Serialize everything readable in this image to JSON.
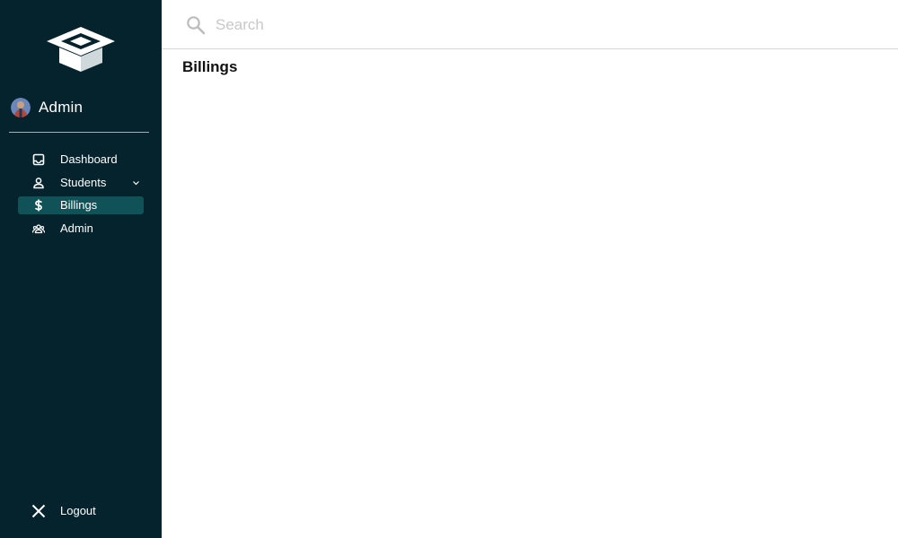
{
  "sidebar": {
    "logo_icon": "graduation-cap-icon",
    "user": {
      "name": "Admin",
      "avatar_icon": "avatar"
    },
    "items": [
      {
        "label": "Dashboard",
        "icon": "inbox-icon",
        "active": false
      },
      {
        "label": "Students",
        "icon": "person-icon",
        "active": false,
        "expandable": true
      },
      {
        "label": "Billings",
        "icon": "dollar-icon",
        "active": true
      },
      {
        "label": "Admin",
        "icon": "group-icon",
        "active": false
      }
    ],
    "logout": {
      "label": "Logout",
      "icon": "close-icon"
    }
  },
  "search": {
    "placeholder": "Search",
    "value": ""
  },
  "main": {
    "title": "Billings"
  },
  "colors": {
    "sidebar_bg": "#04232d",
    "active_item_bg": "#0f5257",
    "text_light": "#ffffff",
    "page_bg": "#ffffff"
  }
}
